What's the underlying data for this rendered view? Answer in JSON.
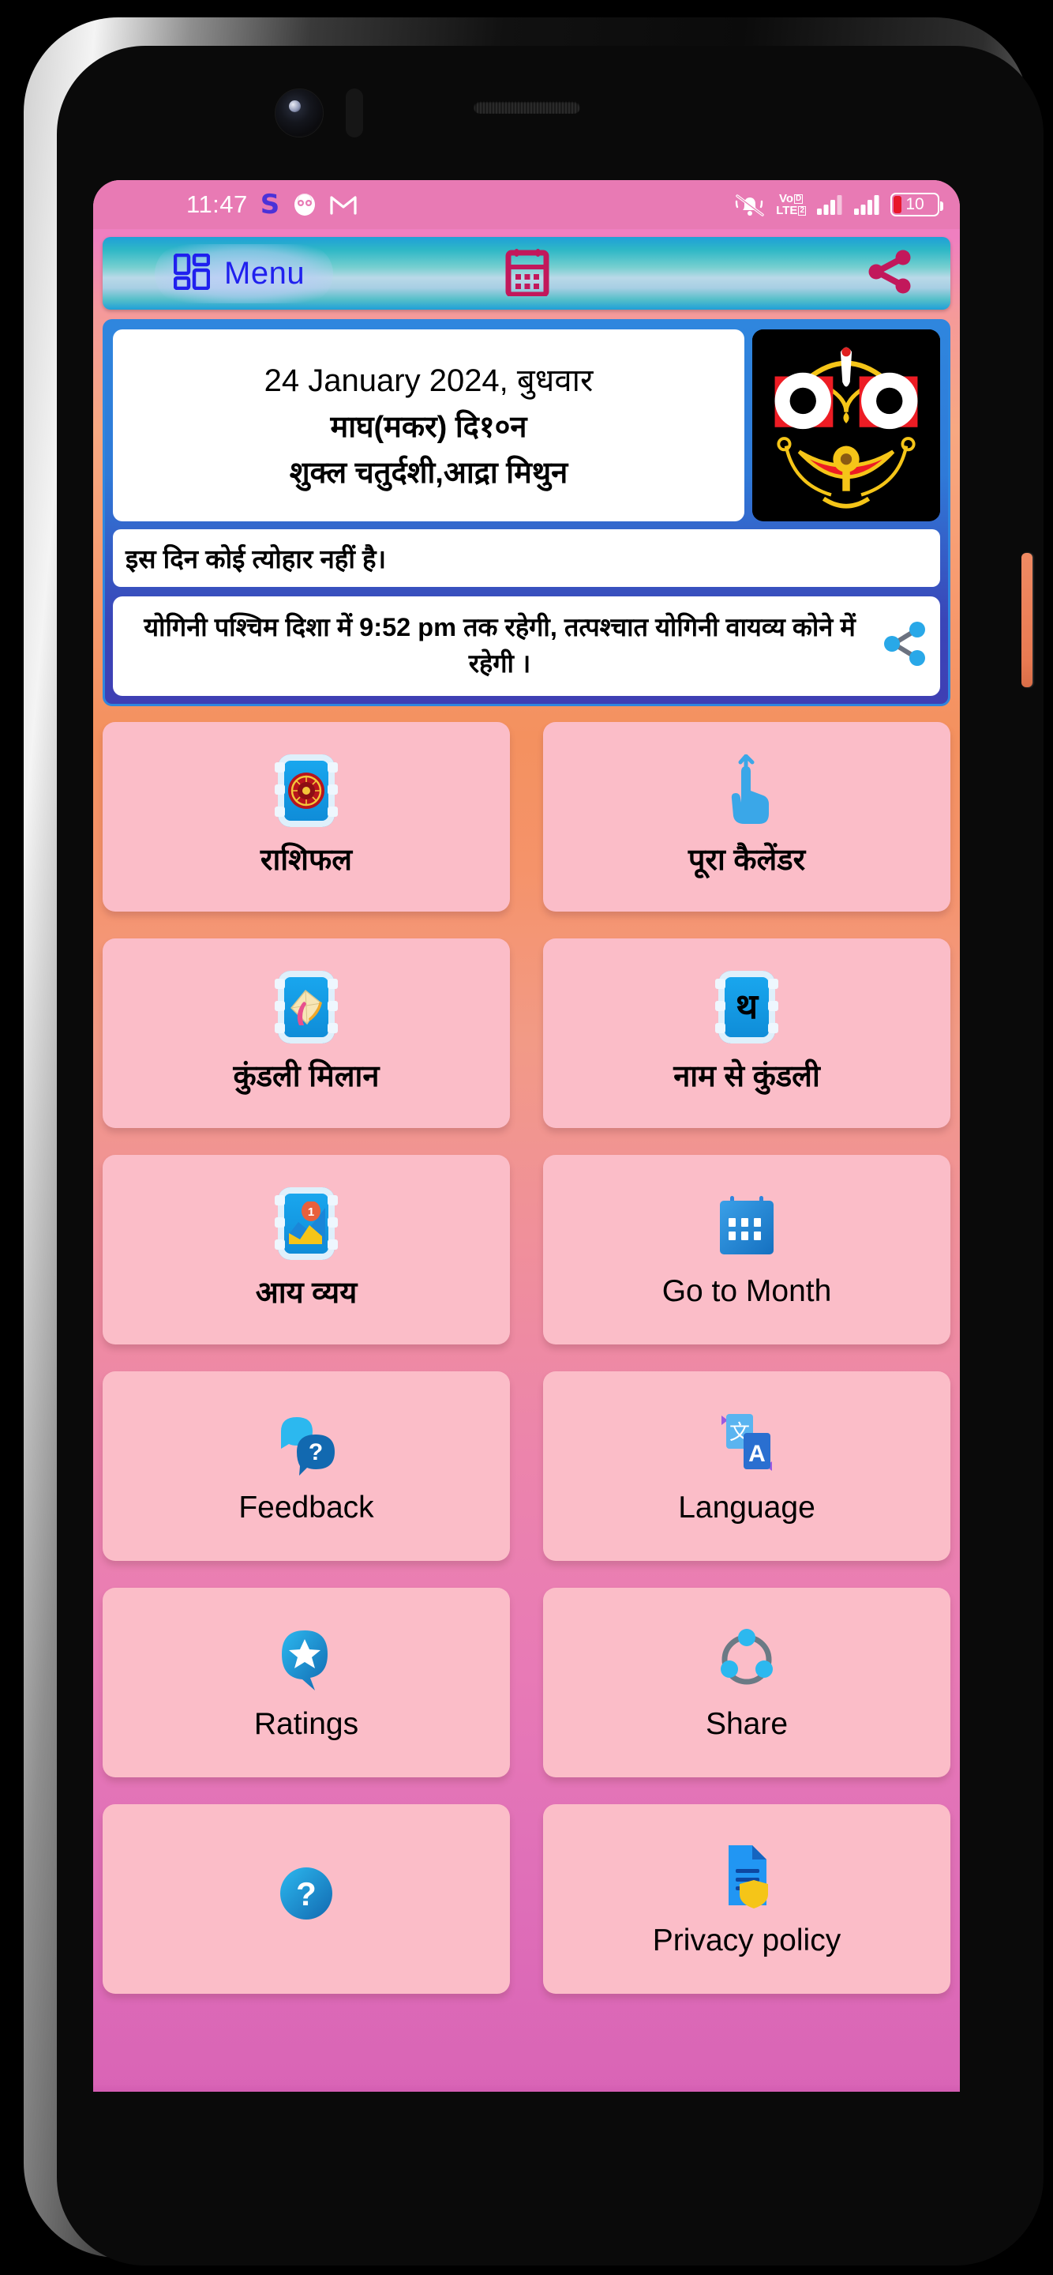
{
  "status_bar": {
    "time": "11:47",
    "left_icons": [
      "skype-icon",
      "snapchat-icon",
      "gmail-icon"
    ],
    "right_icons": [
      "mute-bell-icon",
      "volte-icon",
      "signal-1-icon",
      "signal-2-icon",
      "battery-icon"
    ],
    "volte_primary": "Vo",
    "volte_secondary": "LTE",
    "volte_sim": "2",
    "battery_level": "10"
  },
  "toolbar": {
    "menu_label": "Menu",
    "menu_icon": "grid-menu-icon",
    "calendar_icon": "calendar-icon",
    "share_icon": "share-icon"
  },
  "info_panel": {
    "date_line_1": "24 January 2024, बुधवार",
    "date_line_2": "माघ(मकर) दि१०न",
    "date_line_3": "शुक्ल चतुर्दशी,आद्रा मिथुन",
    "deity_image": "lord-jagannath-face",
    "festival_text": "इस दिन कोई त्योहार नहीं है।",
    "yogini_text": "योगिनी पश्चिम दिशा में 9:52 pm तक रहेगी, तत्पश्चात योगिनी वायव्य कोने में रहेगी ।",
    "yogini_share_icon": "share-icon"
  },
  "menu_grid": {
    "tiles": [
      {
        "label": "राशिफल",
        "icon": "zodiac-wheel-icon",
        "latin": false
      },
      {
        "label": "पूरा कैलेंडर",
        "icon": "pointing-hand-icon",
        "latin": false
      },
      {
        "label": "कुंडली मिलान",
        "icon": "horoscope-chart-icon",
        "latin": false
      },
      {
        "label": "नाम से कुंडली",
        "icon": "letter-tha-icon",
        "latin": false
      },
      {
        "label": "आय व्यय",
        "icon": "expense-chart-icon",
        "latin": false
      },
      {
        "label": "Go to Month",
        "icon": "calendar-month-icon",
        "latin": true
      },
      {
        "label": "Feedback",
        "icon": "question-bubble-icon",
        "latin": true
      },
      {
        "label": "Language",
        "icon": "translate-icon",
        "latin": true
      },
      {
        "label": "Ratings",
        "icon": "star-bubble-icon",
        "latin": true
      },
      {
        "label": "Share",
        "icon": "share-nodes-icon",
        "latin": true
      },
      {
        "label": "",
        "icon": "help-circle-icon",
        "latin": true
      },
      {
        "label": "Privacy policy",
        "icon": "privacy-document-icon",
        "latin": true
      }
    ]
  },
  "colors": {
    "status_bar_bg": "#e87ab4",
    "toolbar_accent": "#2020ee",
    "toolbar_pink_icon": "#c2185b",
    "panel_blue": "#2f86de",
    "tile_bg": "#fbbdc8",
    "battery_red": "#e8172a"
  }
}
